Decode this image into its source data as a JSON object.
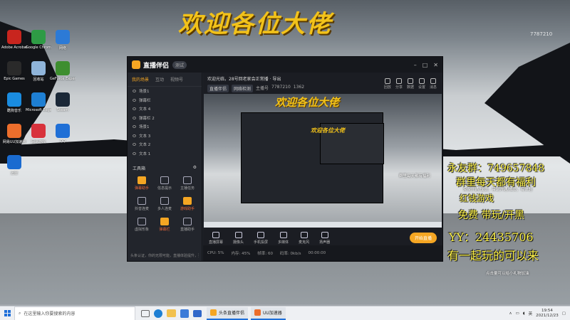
{
  "banner": "欢迎各位大佬",
  "stream_id_top": "7787210",
  "desktop_icons": [
    {
      "label": "Adobe Acrobat",
      "color": "#c8251e"
    },
    {
      "label": "Google Chrome",
      "color": "#2e9b45"
    },
    {
      "label": "网络",
      "color": "#2c7ad6"
    },
    {
      "label": "Epic Games",
      "color": "#2a2a2a"
    },
    {
      "label": "回收站",
      "color": "#8fb4d9"
    },
    {
      "label": "GeForce Experience",
      "color": "#3e8e2f"
    },
    {
      "label": "酷狗音乐",
      "color": "#1a8ce0"
    },
    {
      "label": "Microsoft Edge",
      "color": "#1e7fd3"
    },
    {
      "label": "Steam",
      "color": "#1b2838"
    },
    {
      "label": "网易UU加速器",
      "color": "#ec6e2c"
    },
    {
      "label": "网易游戏",
      "color": "#d8323c"
    },
    {
      "label": "QQ",
      "color": "#1f6fd6"
    },
    {
      "label": "迅雷",
      "color": "#1a6bd0"
    }
  ],
  "app": {
    "name": "直播伴侣",
    "version": "测试",
    "side_tabs": [
      "我的场景",
      "互动",
      "视频号"
    ],
    "sources": [
      "场景1",
      "弹幕栏",
      "文本 4",
      "弹幕栏 2",
      "场景1",
      "文本 3",
      "文本 2",
      "文本 1"
    ],
    "toolbox_label": "工具箱",
    "tools": [
      {
        "label": "弹幕助手",
        "hot": true
      },
      {
        "label": "信息提示",
        "hot": false
      },
      {
        "label": "主播任务",
        "hot": false
      },
      {
        "label": "抖音连麦",
        "hot": false
      },
      {
        "label": "多人连麦",
        "hot": false
      },
      {
        "label": "游戏助手",
        "hot": true
      },
      {
        "label": "虚拟形象",
        "hot": false
      },
      {
        "label": "弹幕栏",
        "hot": true
      },
      {
        "label": "直播助手",
        "hot": false
      }
    ],
    "side_footer": "头条认证，你的无限可能，直播体验提升，更上一层楼",
    "room_title": "欢迎光临，28号回老家会正常播 · 导出",
    "room_chips": [
      "直播伴侣",
      "网络检测",
      "主播号",
      "7787210",
      "1362"
    ],
    "top_icons": [
      "回放",
      "分享",
      "数据",
      "设置",
      "消息"
    ],
    "preview_banner": "欢迎各位大佬",
    "preview_banner_small": "欢迎各位大佬",
    "controls": [
      "直播屏幕",
      "摄像头",
      "手机投屏",
      "多媒体",
      "麦克风",
      "扬声器"
    ],
    "go_live": "开始直播",
    "status": [
      "CPU: 5%",
      "内存: 45%",
      "帧率: 60",
      "码率: 0kb/s",
      "00:00:00"
    ]
  },
  "promo": {
    "line1": "永友群：749657848",
    "line2": "群里每天都有福利",
    "line3": "红钱游戏",
    "line4": "免费 带玩/开黑",
    "line5": "YY：24435706",
    "line6": "有一起玩的可以来",
    "small1": "群里每天都有福利",
    "small2": "免费开通/成员，带玩开通/成员，有体验",
    "small3": "点击量可以给小礼物加油"
  },
  "taskbar": {
    "search_placeholder": "在这里输入你要搜索的内容",
    "apps": [
      {
        "label": "头条直播伴侣",
        "color": "#f5a623"
      },
      {
        "label": "UU加速器",
        "color": "#ec6e2c"
      }
    ],
    "time": "19:54",
    "date": "2021/12/23",
    "lang": "英"
  }
}
